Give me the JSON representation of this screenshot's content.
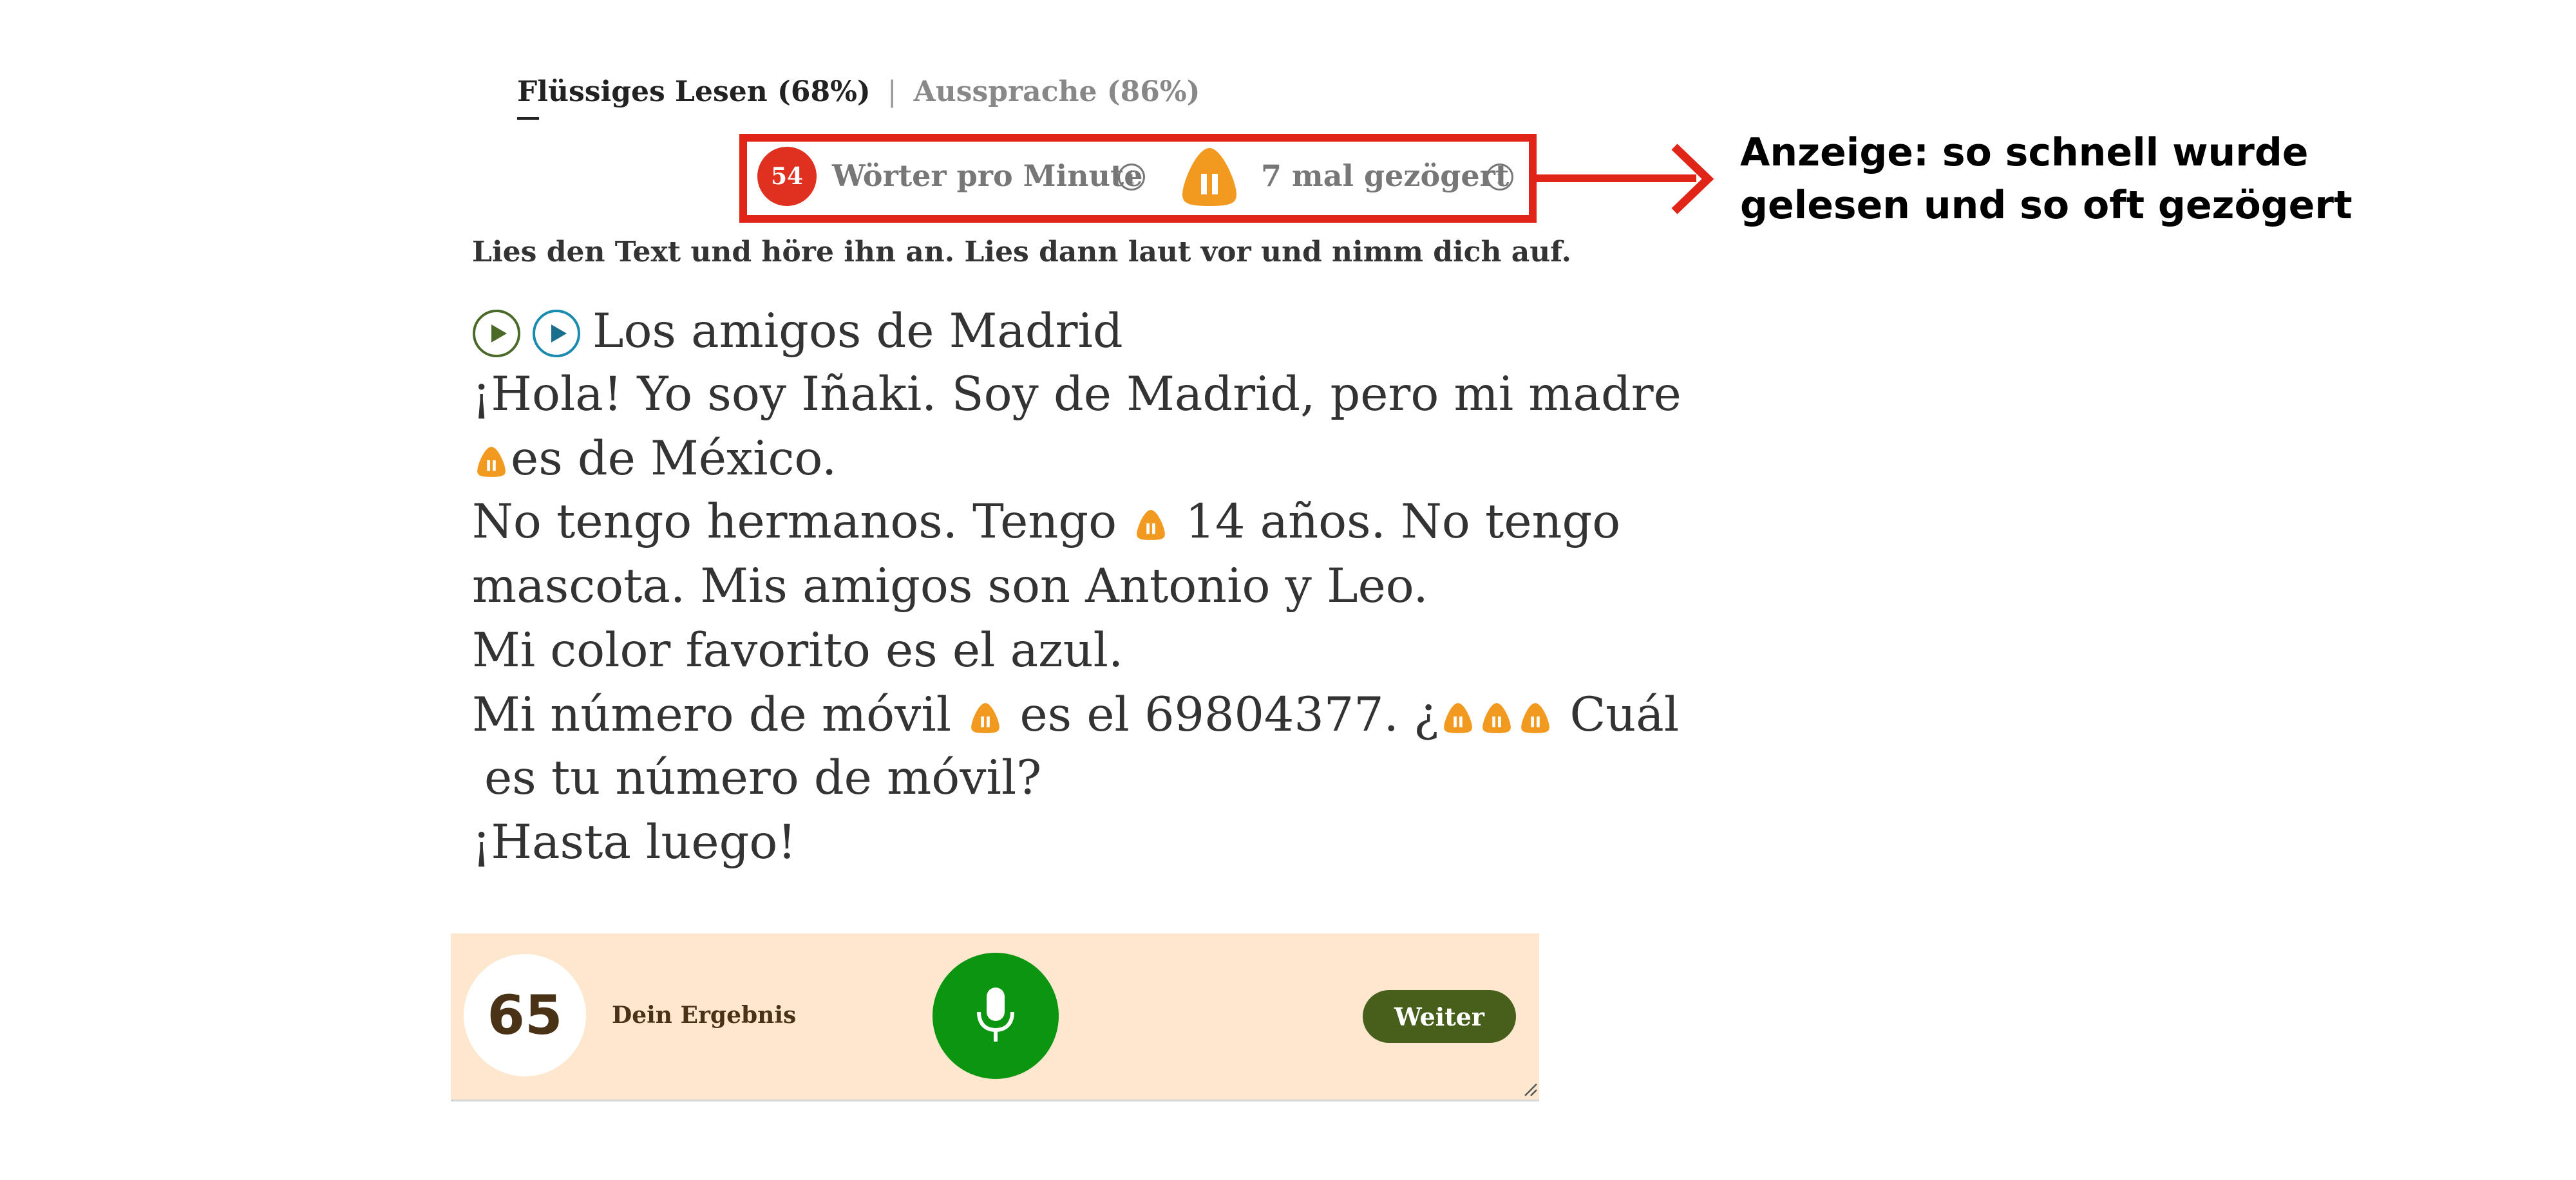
{
  "tabs": {
    "active_label": "Flüssiges Lesen (68%)",
    "separator": "|",
    "inactive_label": "Aussprache (86%)"
  },
  "stats": {
    "wpm_value": "54",
    "wpm_label": "Wörter pro Minute",
    "hesitation_label": "7 mal gezögert",
    "info_glyph": "i"
  },
  "annotation": {
    "line1": "Anzeige: so schnell wurde",
    "line2": "gelesen und so oft gezögert"
  },
  "instruction": "Lies den Text und höre ihn an. Lies dann laut vor und nimm dich auf.",
  "reading": {
    "title": "Los amigos de Madrid",
    "line1": "¡Hola! Yo soy Iñaki. Soy de Madrid, pero mi madre",
    "line2": "es de México.",
    "line3a": "No tengo hermanos. Tengo",
    "line3b": "14 años. No tengo",
    "line4": "mascota. Mis amigos son Antonio y Leo.",
    "line5": "Mi color favorito es el azul.",
    "line6a": "Mi número de móvil",
    "line6b": "es el 69804377. ¿",
    "line6c": "Cuál",
    "line7": "es tu número de móvil?",
    "line8": "¡Hasta luego!"
  },
  "footer": {
    "score": "65",
    "score_label": "Dein Ergebnis",
    "next_button": "Weiter"
  },
  "colors": {
    "accent_red": "#e0301f",
    "hesitation_orange": "#f29a1f",
    "mic_green": "#0c9511",
    "next_button": "#475f1b",
    "footer_bg": "#fde7ce"
  },
  "icons": {
    "play_original": "play-icon",
    "play_recording": "play-icon",
    "hesitation": "pause-icon",
    "microphone": "microphone-icon",
    "info": "info-icon"
  }
}
